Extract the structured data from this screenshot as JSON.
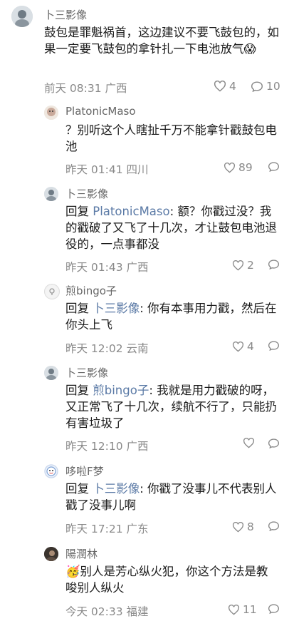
{
  "comments": [
    {
      "author": "卜三影像",
      "text": "鼓包是罪魁祸首，这边建议不要飞鼓包的，如果一定要飞鼓包的拿针扎一下电池放气",
      "emoji": "😱",
      "time": "前天 08:31",
      "region": "广西",
      "likes": "4",
      "replies": "10"
    }
  ],
  "replies": [
    {
      "author": "PlatonicMaso",
      "text": "？别听这个人瞎扯千万不能拿针戳鼓包电池",
      "time": "昨天 01:41",
      "region": "四川",
      "likes": "89"
    },
    {
      "author": "卜三影像",
      "prefix": "回复",
      "mention": "PlatonicMaso",
      "text": ": 额？你戳过没？我的戳破了又飞了十几次，才让鼓包电池退役的，一点事都没",
      "time": "昨天 01:43",
      "region": "广西",
      "likes": "2"
    },
    {
      "author": "煎bingo子",
      "prefix": "回复",
      "mention": "卜三影像",
      "text": ": 你有本事用力戳，然后在你头上飞",
      "time": "昨天 12:02",
      "region": "云南",
      "likes": "4"
    },
    {
      "author": "卜三影像",
      "prefix": "回复",
      "mention": "煎bingo子",
      "text": ": 我就是用力戳破的呀，又正常飞了十几次，续航不行了，只能扔有害垃圾了",
      "time": "昨天 12:10",
      "region": "广西",
      "likes": ""
    },
    {
      "author": "哆啦F梦",
      "prefix": "回复",
      "mention": "卜三影像",
      "text": ": 你戳了没事儿不代表别人戳了没事儿啊",
      "time": "昨天 17:21",
      "region": "广东",
      "likes": "8"
    },
    {
      "author": "陽潤林",
      "emoji": "🥳",
      "text": "别人是芳心纵火犯，你这个方法是教唆别人纵火",
      "time": "今天 02:33",
      "region": "福建",
      "likes": "11"
    }
  ]
}
